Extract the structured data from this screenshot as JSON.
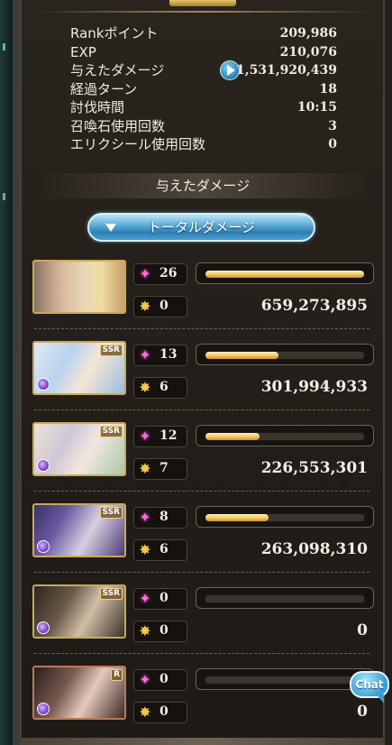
{
  "stats": [
    {
      "label": "Rankポイント",
      "value": "209,986"
    },
    {
      "label": "EXP",
      "value": "210,076"
    },
    {
      "label": "与えたダメージ",
      "value": "1,531,920,439"
    },
    {
      "label": "経過ターン",
      "value": "18"
    },
    {
      "label": "討伐時間",
      "value": "10:15"
    },
    {
      "label": "召喚石使用回数",
      "value": "3"
    },
    {
      "label": "エリクシール使用回数",
      "value": "0"
    }
  ],
  "section_title": "与えたダメージ",
  "total_button_label": "トータルダメージ",
  "characters": [
    {
      "rarity": "",
      "element_icon": false,
      "skill_uses": "26",
      "ougi_uses": "0",
      "damage_fraction": 1.0,
      "damage": "659,273,895"
    },
    {
      "rarity": "SSR",
      "element_icon": true,
      "skill_uses": "13",
      "ougi_uses": "6",
      "damage_fraction": 0.46,
      "damage": "301,994,933"
    },
    {
      "rarity": "SSR",
      "element_icon": true,
      "skill_uses": "12",
      "ougi_uses": "7",
      "damage_fraction": 0.34,
      "damage": "226,553,301"
    },
    {
      "rarity": "SSR",
      "element_icon": true,
      "skill_uses": "8",
      "ougi_uses": "6",
      "damage_fraction": 0.4,
      "damage": "263,098,310"
    },
    {
      "rarity": "SSR",
      "element_icon": true,
      "skill_uses": "0",
      "ougi_uses": "0",
      "damage_fraction": 0,
      "damage": "0"
    },
    {
      "rarity": "R",
      "element_icon": true,
      "skill_uses": "0",
      "ougi_uses": "0",
      "damage_fraction": 0,
      "damage": "0"
    }
  ],
  "chat_button_label": "Chat",
  "colors": {
    "accent_blue": "#3b9fd6",
    "bar_gold": "#f0c15a",
    "skill_pink": "#ff6bd8"
  }
}
